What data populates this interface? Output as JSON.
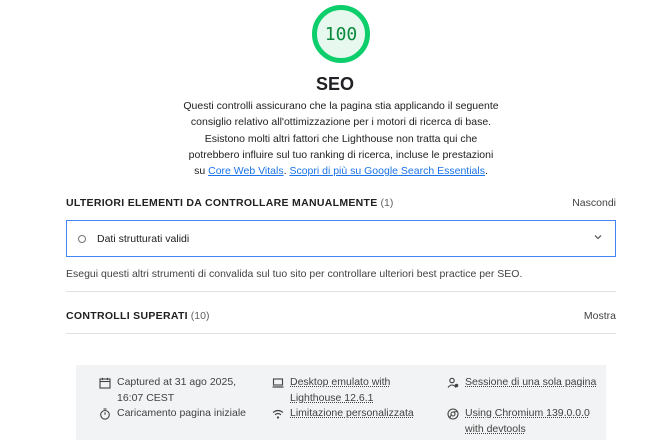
{
  "score": {
    "value": "100",
    "color": "#0cce6b"
  },
  "category": {
    "title": "SEO",
    "description_text": "Questi controlli assicurano che la pagina stia applicando il seguente consiglio relativo all'ottimizzazione per i motori di ricerca di base. Esistono molti altri fattori che Lighthouse non tratta qui che potrebbero influire sul tuo ranking di ricerca, incluse le prestazioni su ",
    "link1": "Core Web Vitals",
    "between": ". ",
    "link2": "Scopri di più su Google Search Essentials",
    "end": "."
  },
  "manual_group": {
    "title": "ULTERIORI ELEMENTI DA CONTROLLARE MANUALMENTE",
    "count": "(1)",
    "toggle": "Nascondi",
    "audits": [
      {
        "label": "Dati strutturati validi"
      }
    ],
    "note": "Esegui questi altri strumenti di convalida sul tuo sito per controllare ulteriori best practice per SEO."
  },
  "passed_group": {
    "title": "CONTROLLI SUPERATI",
    "count": "(10)",
    "toggle": "Mostra"
  },
  "footer": {
    "captured": "Captured at 31 ago 2025, 16:07 CEST",
    "load": "Caricamento pagina iniziale",
    "device": "Desktop emulato with Lighthouse 12.6.1",
    "throttling": "Limitazione personalizzata",
    "session": "Sessione di una sola pagina",
    "browser": "Using Chromium 139.0.0.0 with devtools"
  },
  "icons": {
    "calendar": "calendar-icon",
    "timer": "timer-icon",
    "device": "laptop-icon",
    "throttle": "wifi-icon",
    "session": "user-session-icon",
    "browser": "chromium-icon"
  },
  "accent_link_color": "#1a73e8"
}
